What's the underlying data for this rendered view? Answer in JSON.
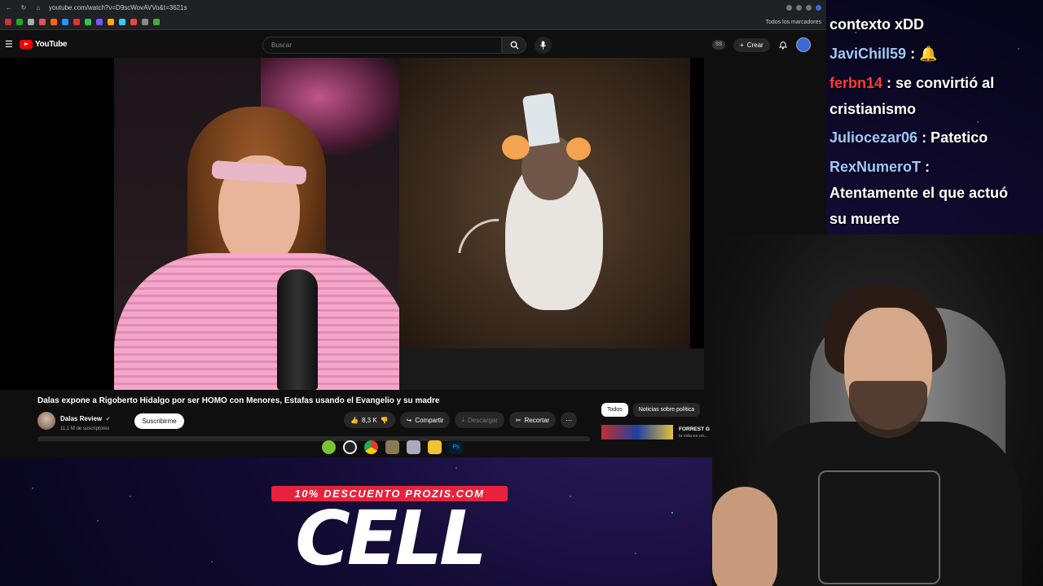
{
  "browser": {
    "url": "youtube.com/watch?v=D9scWovAVVo&t=3621s",
    "bookmarks_label": "Todos los marcadores"
  },
  "youtube": {
    "logo_text": "YouTube",
    "search_placeholder": "Buscar",
    "badge": "SS",
    "create_label": "Crear"
  },
  "video": {
    "title": "Dalas expone a Rigoberto Hidalgo por ser HOMO con Menores, Estafas usando el Evangelio y su madre",
    "channel_name": "Dalas Review",
    "subscribers": "11,1 M de suscriptores",
    "subscribe_label": "Suscribirme",
    "likes": "8,3 K",
    "share_label": "Compartir",
    "download_label": "Descargar",
    "clip_label": "Recortar"
  },
  "chips": [
    "Todos",
    "Noticias sobre política"
  ],
  "recommendation": {
    "title": "FORREST G",
    "subtitle": "la vida es un..."
  },
  "chat": [
    {
      "user": "",
      "message": "contexto xDD",
      "color": "#ffffff"
    },
    {
      "user": "JaviChill59",
      "message": " : 🔔",
      "color": "#9ec8ff"
    },
    {
      "user": "ferbn14",
      "message": " : se convirtió al",
      "color": "#ff3b3b"
    },
    {
      "user": "",
      "message": "cristianismo",
      "color": "#ffffff"
    },
    {
      "user": "Juliocezar06",
      "message": " : Patetico",
      "color": "#9ec8ff"
    },
    {
      "user": "RexNumeroT",
      "message": " :",
      "color": "#9ec8ff"
    },
    {
      "user": "",
      "message": "Atentamente el que actuó",
      "color": "#ffffff"
    },
    {
      "user": "",
      "message": "su muerte",
      "color": "#ffffff"
    }
  ],
  "promo": {
    "tag": "10% DESCUENTO PROZIS.COM",
    "title": "CELL"
  }
}
